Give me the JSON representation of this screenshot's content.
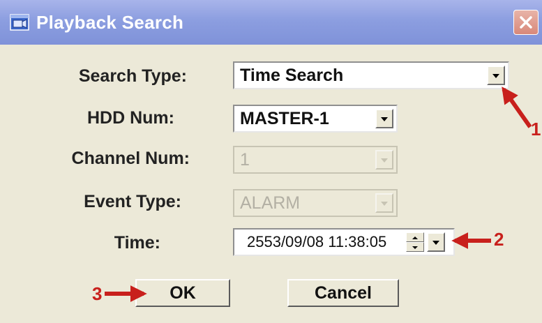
{
  "window": {
    "title": "Playback Search",
    "icon": "video-window-icon",
    "close_icon": "close-icon"
  },
  "form": {
    "search_type": {
      "label": "Search Type:",
      "value": "Time Search",
      "enabled": true
    },
    "hdd_num": {
      "label": "HDD Num:",
      "value": "MASTER-1",
      "enabled": true
    },
    "channel_num": {
      "label": "Channel Num:",
      "value": "1",
      "enabled": false
    },
    "event_type": {
      "label": "Event Type:",
      "value": "ALARM",
      "enabled": false
    },
    "time": {
      "label": "Time:",
      "value": "2553/09/08 11:38:05"
    }
  },
  "buttons": {
    "ok": "OK",
    "cancel": "Cancel"
  },
  "annotations": {
    "arrow_color": "#c8201c",
    "callouts": [
      "1",
      "2",
      "3"
    ]
  }
}
